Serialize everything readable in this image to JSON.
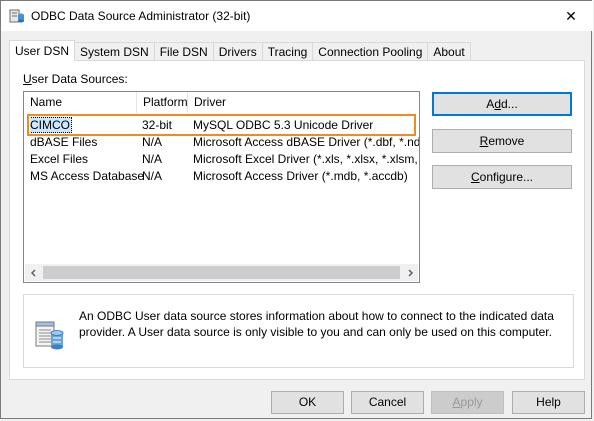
{
  "window": {
    "title": "ODBC Data Source Administrator (32-bit)",
    "close_glyph": "✕"
  },
  "tabs": [
    {
      "label": "User DSN",
      "active": true
    },
    {
      "label": "System DSN"
    },
    {
      "label": "File DSN"
    },
    {
      "label": "Drivers"
    },
    {
      "label": "Tracing"
    },
    {
      "label": "Connection Pooling"
    },
    {
      "label": "About"
    }
  ],
  "user_dsn": {
    "section_label_prefix": "U",
    "section_label_rest": "ser Data Sources:",
    "columns": [
      "Name",
      "Platform",
      "Driver"
    ],
    "rows": [
      {
        "name": "CIMCO",
        "platform": "32-bit",
        "driver": "MySQL ODBC 5.3 Unicode Driver",
        "selected": true
      },
      {
        "name": "dBASE Files",
        "platform": "N/A",
        "driver": "Microsoft Access dBASE Driver (*.dbf, *.ndx, *.m"
      },
      {
        "name": "Excel Files",
        "platform": "N/A",
        "driver": "Microsoft Excel Driver (*.xls, *.xlsx, *.xlsm, *.xlsb)"
      },
      {
        "name": "MS Access Database",
        "platform": "N/A",
        "driver": "Microsoft Access Driver (*.mdb, *.accdb)"
      }
    ],
    "buttons": {
      "add_pre": "A",
      "add_u": "d",
      "add_post": "d...",
      "remove_u": "R",
      "remove_post": "emove",
      "configure_u": "C",
      "configure_post": "onfigure..."
    },
    "info_text": "An ODBC User data source stores information about how to connect to the indicated data provider.  A User data source is only visible to you and can only be used on this computer."
  },
  "footer": {
    "ok": "OK",
    "cancel": "Cancel",
    "apply_u": "A",
    "apply_post": "pply",
    "help": "Help"
  },
  "colors": {
    "accent": "#0078d7",
    "highlight": "#f08a24",
    "selection": "#cce8ff"
  }
}
